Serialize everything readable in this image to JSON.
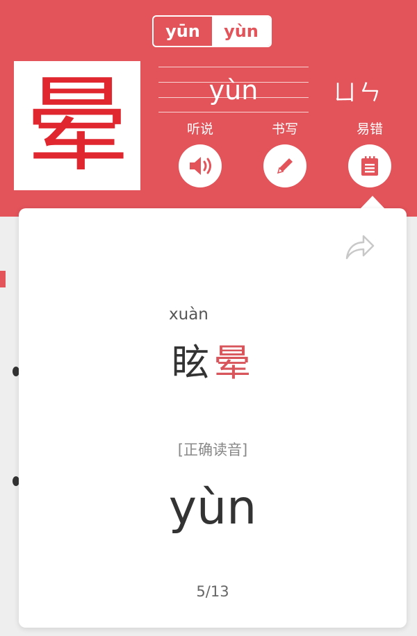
{
  "header": {
    "pinyin_tabs": [
      {
        "label": "yūn",
        "selected": false
      },
      {
        "label": "yùn",
        "selected": true
      }
    ],
    "character": "晕",
    "pinyin": "yùn",
    "zhuyin": "ㄩㄣ",
    "actions": [
      {
        "label": "听说",
        "icon": "speaker-icon"
      },
      {
        "label": "书写",
        "icon": "pencil-icon"
      },
      {
        "label": "易错",
        "icon": "notepad-icon"
      }
    ]
  },
  "card": {
    "share_icon": "share-icon",
    "word_pinyin": "xuàn",
    "word_chars": [
      "眩",
      "晕"
    ],
    "correct_label": "[正确读音]",
    "correct_pinyin": "yùn",
    "page_counter": "5/13"
  },
  "colors": {
    "brand_red": "#e2535a",
    "character_red": "#e0262e",
    "highlight_red": "#d8555c"
  }
}
